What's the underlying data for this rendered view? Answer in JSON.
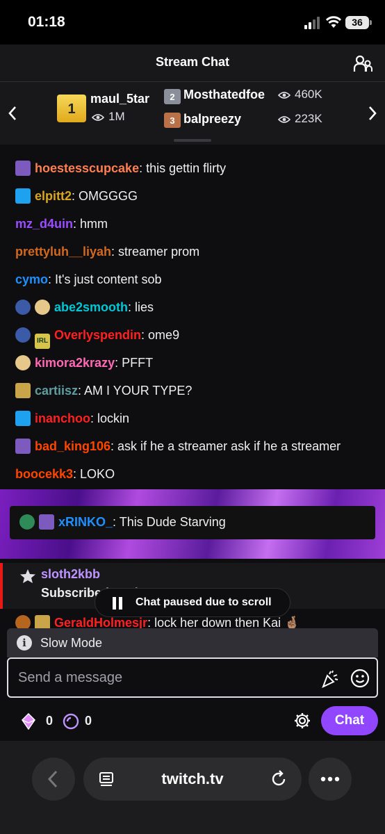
{
  "status_bar": {
    "time": "01:18",
    "battery": "36"
  },
  "header": {
    "title": "Stream Chat"
  },
  "leaderboard": {
    "first": {
      "rank": "1",
      "name": "maul_5tar",
      "viewers": "1M"
    },
    "second": {
      "rank": "2",
      "name": "Mosthatedfoe",
      "viewers": "460K"
    },
    "third": {
      "rank": "3",
      "name": "balpreezy",
      "viewers": "223K"
    }
  },
  "chat": {
    "messages": [
      {
        "user": "hoestesscupcake",
        "text": ": this gettin flirty",
        "user_color": "#ff7f50"
      },
      {
        "user": "elpitt2",
        "text": ": OMGGGG",
        "user_color": "#daa520"
      },
      {
        "user": "mz_d4uin",
        "text": ": hmm",
        "user_color": "#9b4dff"
      },
      {
        "user": "prettyluh__liyah",
        "text": ": streamer prom",
        "user_color": "#d2691e"
      },
      {
        "user": "cymo",
        "text": ": It's just content sob",
        "user_color": "#1e90ff"
      },
      {
        "user": "abe2smooth",
        "text": ": lies",
        "user_color": "#00c8d7"
      },
      {
        "user": "Overlyspendin",
        "text": ": ome9",
        "user_color": "#ff2020"
      },
      {
        "user": "kimora2krazy",
        "text": ": PFFT",
        "user_color": "#ff69b4"
      },
      {
        "user": "cartiisz",
        "text": ": AM I YOUR TYPE?",
        "user_color": "#5f9ea0"
      },
      {
        "user": "inanchoo",
        "text": ": lockin",
        "user_color": "#ff2020"
      },
      {
        "user": "bad_king106",
        "text": ": ask if he a streamer ask if he a streamer",
        "user_color": "#ff4500"
      },
      {
        "user": "boocekk3",
        "text": ": LOKO",
        "user_color": "#ff4500"
      }
    ],
    "highlighted": {
      "user": "xRINKO_",
      "text": ": This Dude Starving",
      "user_color": "#1e90ff"
    },
    "subscription": {
      "user": "sloth2kbb",
      "text": "Subscribed at Tier 1"
    },
    "paused_label": "Chat paused due to scroll",
    "last_message": {
      "user": "GeraldHolmesjr",
      "text": ": lock her down then Kai 🤞🏽",
      "user_color": "#ff2020"
    }
  },
  "slow_mode": {
    "label": "Slow Mode"
  },
  "input": {
    "placeholder": "Send a message"
  },
  "footer": {
    "bits": "0",
    "points": "0",
    "chat_button": "Chat"
  },
  "browser": {
    "url": "twitch.tv"
  },
  "colors": {
    "accent": "#9147ff",
    "sub_border": "#e91916",
    "sub_user": "#bf94ff"
  }
}
